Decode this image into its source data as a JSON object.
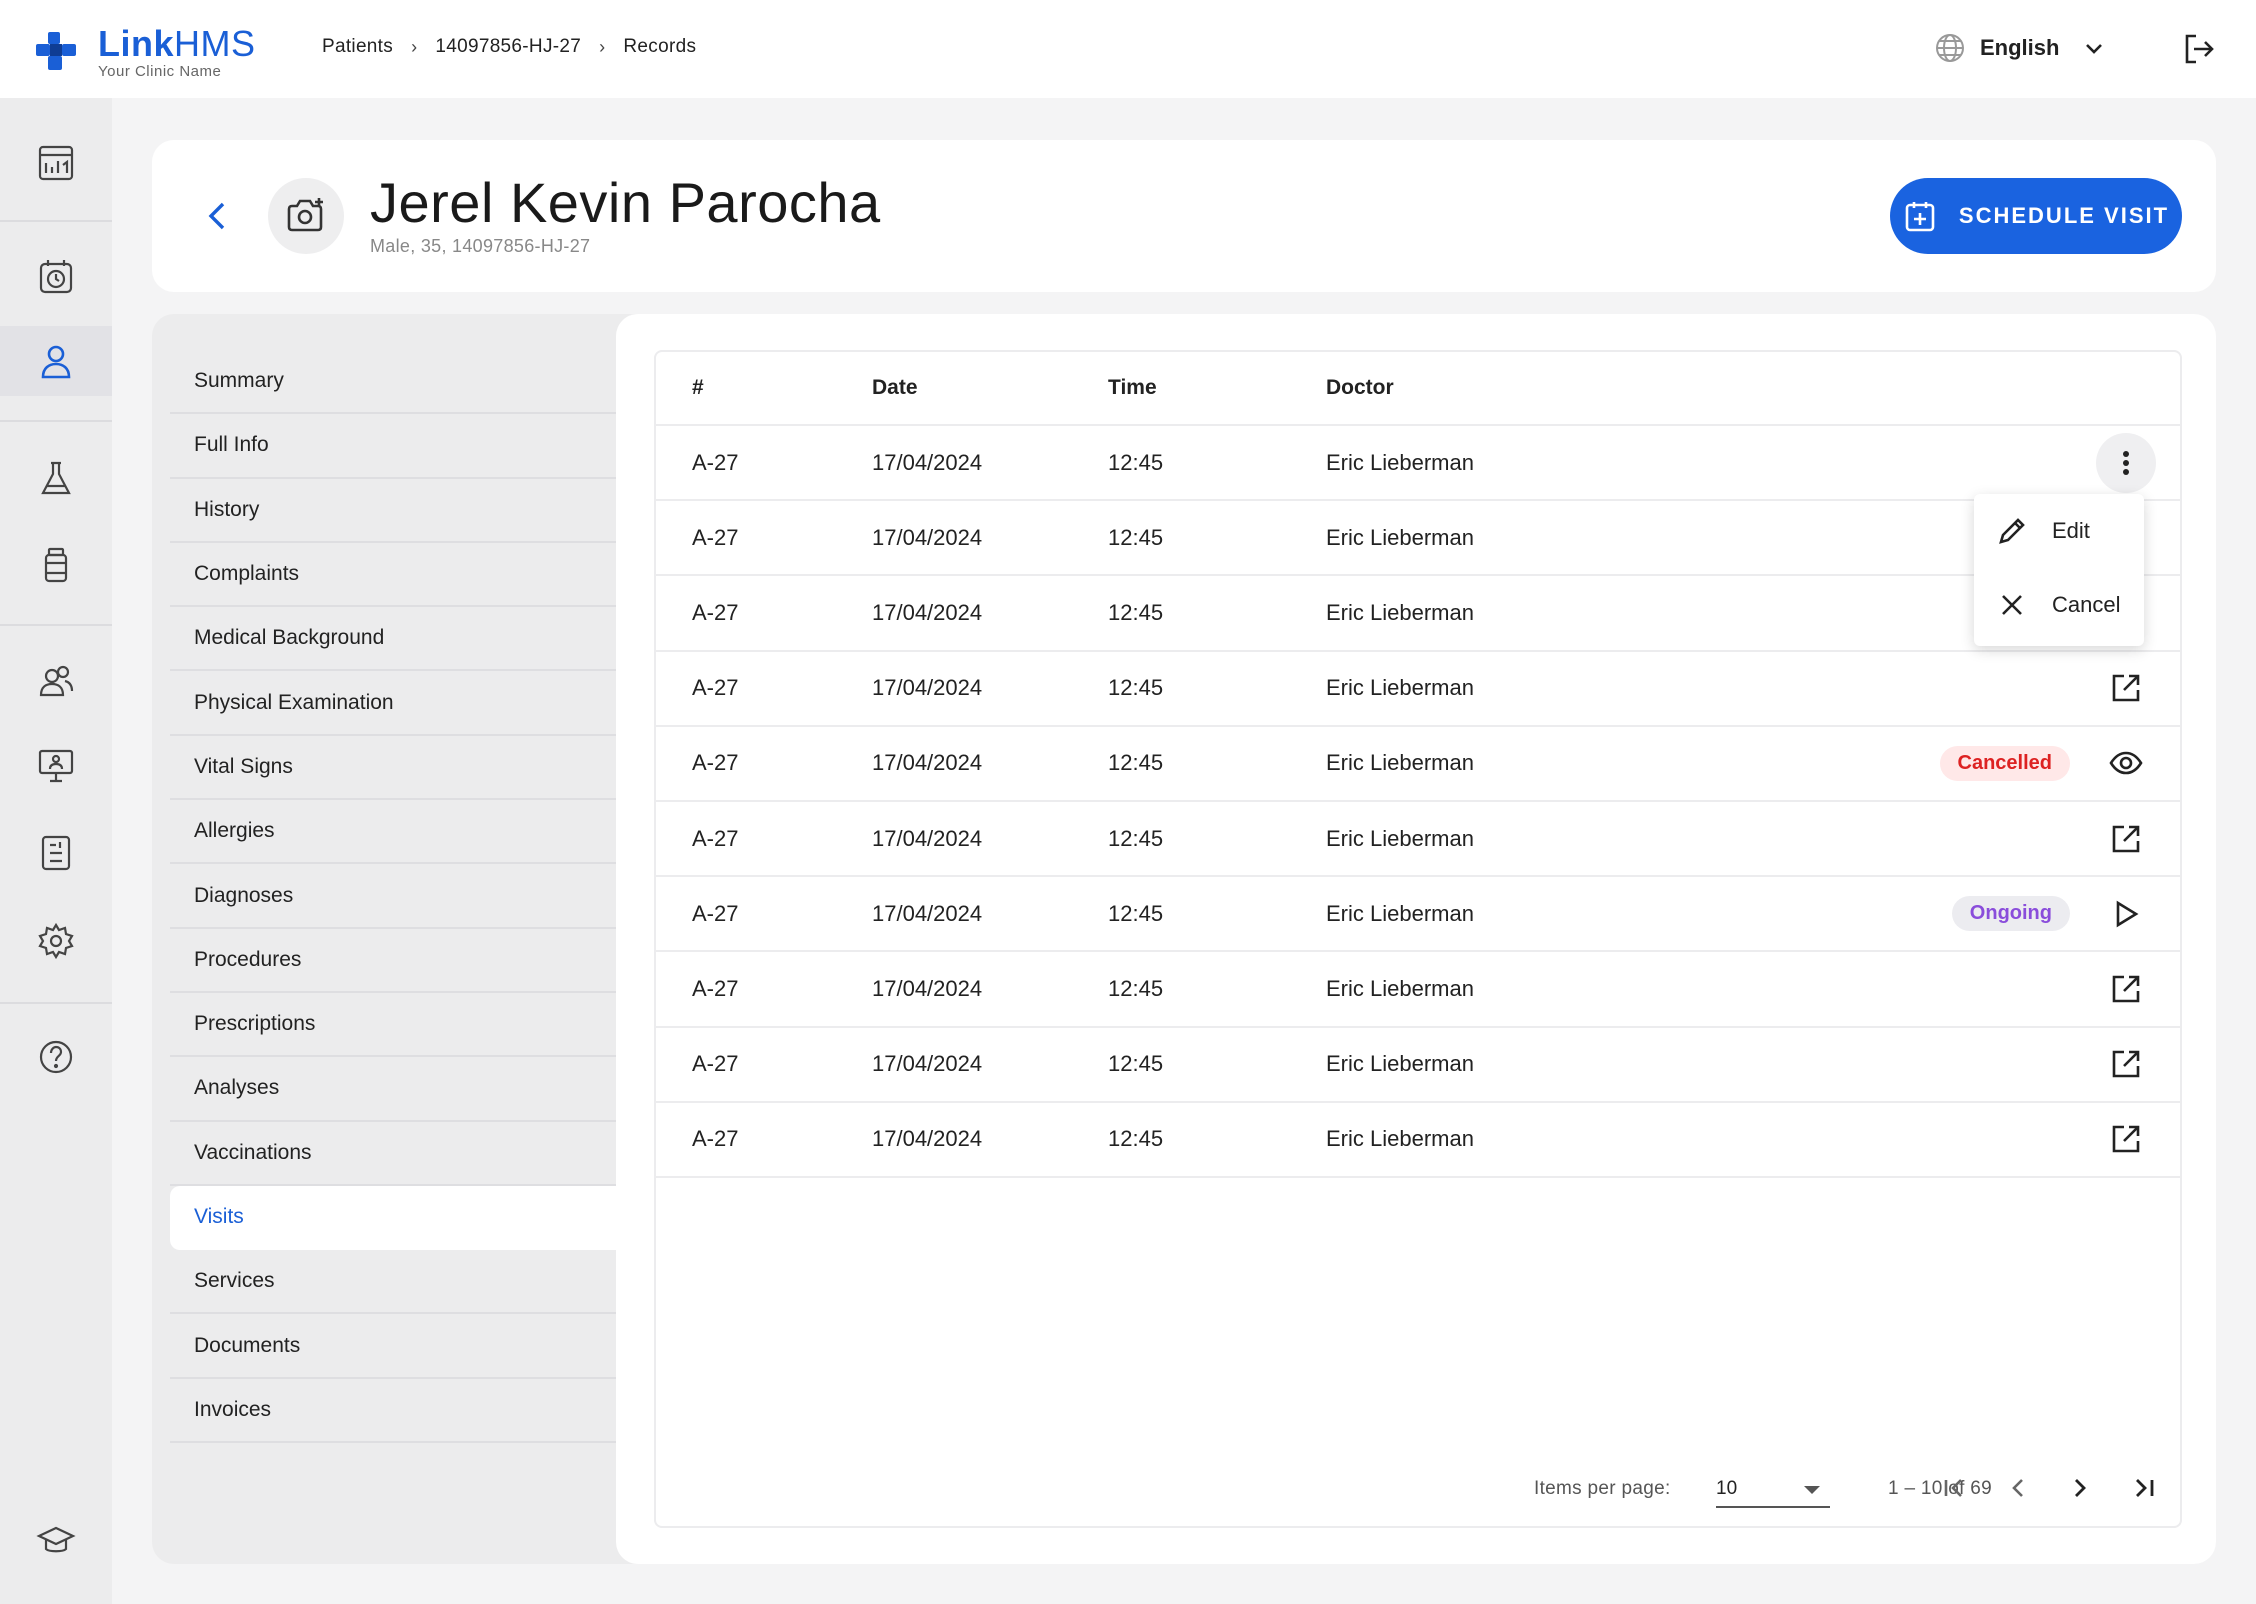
{
  "brand": {
    "title_link": "Link",
    "title_hms": "HMS",
    "subtitle": "Your Clinic Name"
  },
  "breadcrumb": [
    "Patients",
    "14097856-HJ-27",
    "Records"
  ],
  "language": "English",
  "patient": {
    "name": "Jerel Kevin Parocha",
    "meta": "Male, 35, 14097856-HJ-27"
  },
  "schedule_button": "SCHEDULE VISIT",
  "nav": [
    "Summary",
    "Full Info",
    "History",
    "Complaints",
    "Medical Background",
    "Physical Examination",
    "Vital Signs",
    "Allergies",
    "Diagnoses",
    "Procedures",
    "Prescriptions",
    "Analyses",
    "Vaccinations",
    "Visits",
    "Services",
    "Documents",
    "Invoices"
  ],
  "active_nav": "Visits",
  "table": {
    "headers": [
      "#",
      "Date",
      "Time",
      "Doctor"
    ],
    "rows": [
      {
        "num": "A-27",
        "date": "17/04/2024",
        "time": "12:45",
        "doctor": "Eric Lieberman",
        "status": "",
        "action": "more-vert-icon"
      },
      {
        "num": "A-27",
        "date": "17/04/2024",
        "time": "12:45",
        "doctor": "Eric Lieberman",
        "status": "",
        "action": ""
      },
      {
        "num": "A-27",
        "date": "17/04/2024",
        "time": "12:45",
        "doctor": "Eric Lieberman",
        "status": "",
        "action": ""
      },
      {
        "num": "A-27",
        "date": "17/04/2024",
        "time": "12:45",
        "doctor": "Eric Lieberman",
        "status": "",
        "action": "open-external-icon"
      },
      {
        "num": "A-27",
        "date": "17/04/2024",
        "time": "12:45",
        "doctor": "Eric Lieberman",
        "status": "Cancelled",
        "action": "eye-icon"
      },
      {
        "num": "A-27",
        "date": "17/04/2024",
        "time": "12:45",
        "doctor": "Eric Lieberman",
        "status": "",
        "action": "open-external-icon"
      },
      {
        "num": "A-27",
        "date": "17/04/2024",
        "time": "12:45",
        "doctor": "Eric Lieberman",
        "status": "Ongoing",
        "action": "play-icon"
      },
      {
        "num": "A-27",
        "date": "17/04/2024",
        "time": "12:45",
        "doctor": "Eric Lieberman",
        "status": "",
        "action": "open-external-icon"
      },
      {
        "num": "A-27",
        "date": "17/04/2024",
        "time": "12:45",
        "doctor": "Eric Lieberman",
        "status": "",
        "action": "open-external-icon"
      },
      {
        "num": "A-27",
        "date": "17/04/2024",
        "time": "12:45",
        "doctor": "Eric Lieberman",
        "status": "",
        "action": "open-external-icon"
      }
    ]
  },
  "row_menu": {
    "edit": "Edit",
    "cancel": "Cancel"
  },
  "pagination": {
    "items_label": "Items per page:",
    "items_value": "10",
    "range": "1 – 10 of 69"
  },
  "colors": {
    "accent": "#1a63e0",
    "cancelled": "#dd2222",
    "ongoing": "#8a4ddb"
  }
}
